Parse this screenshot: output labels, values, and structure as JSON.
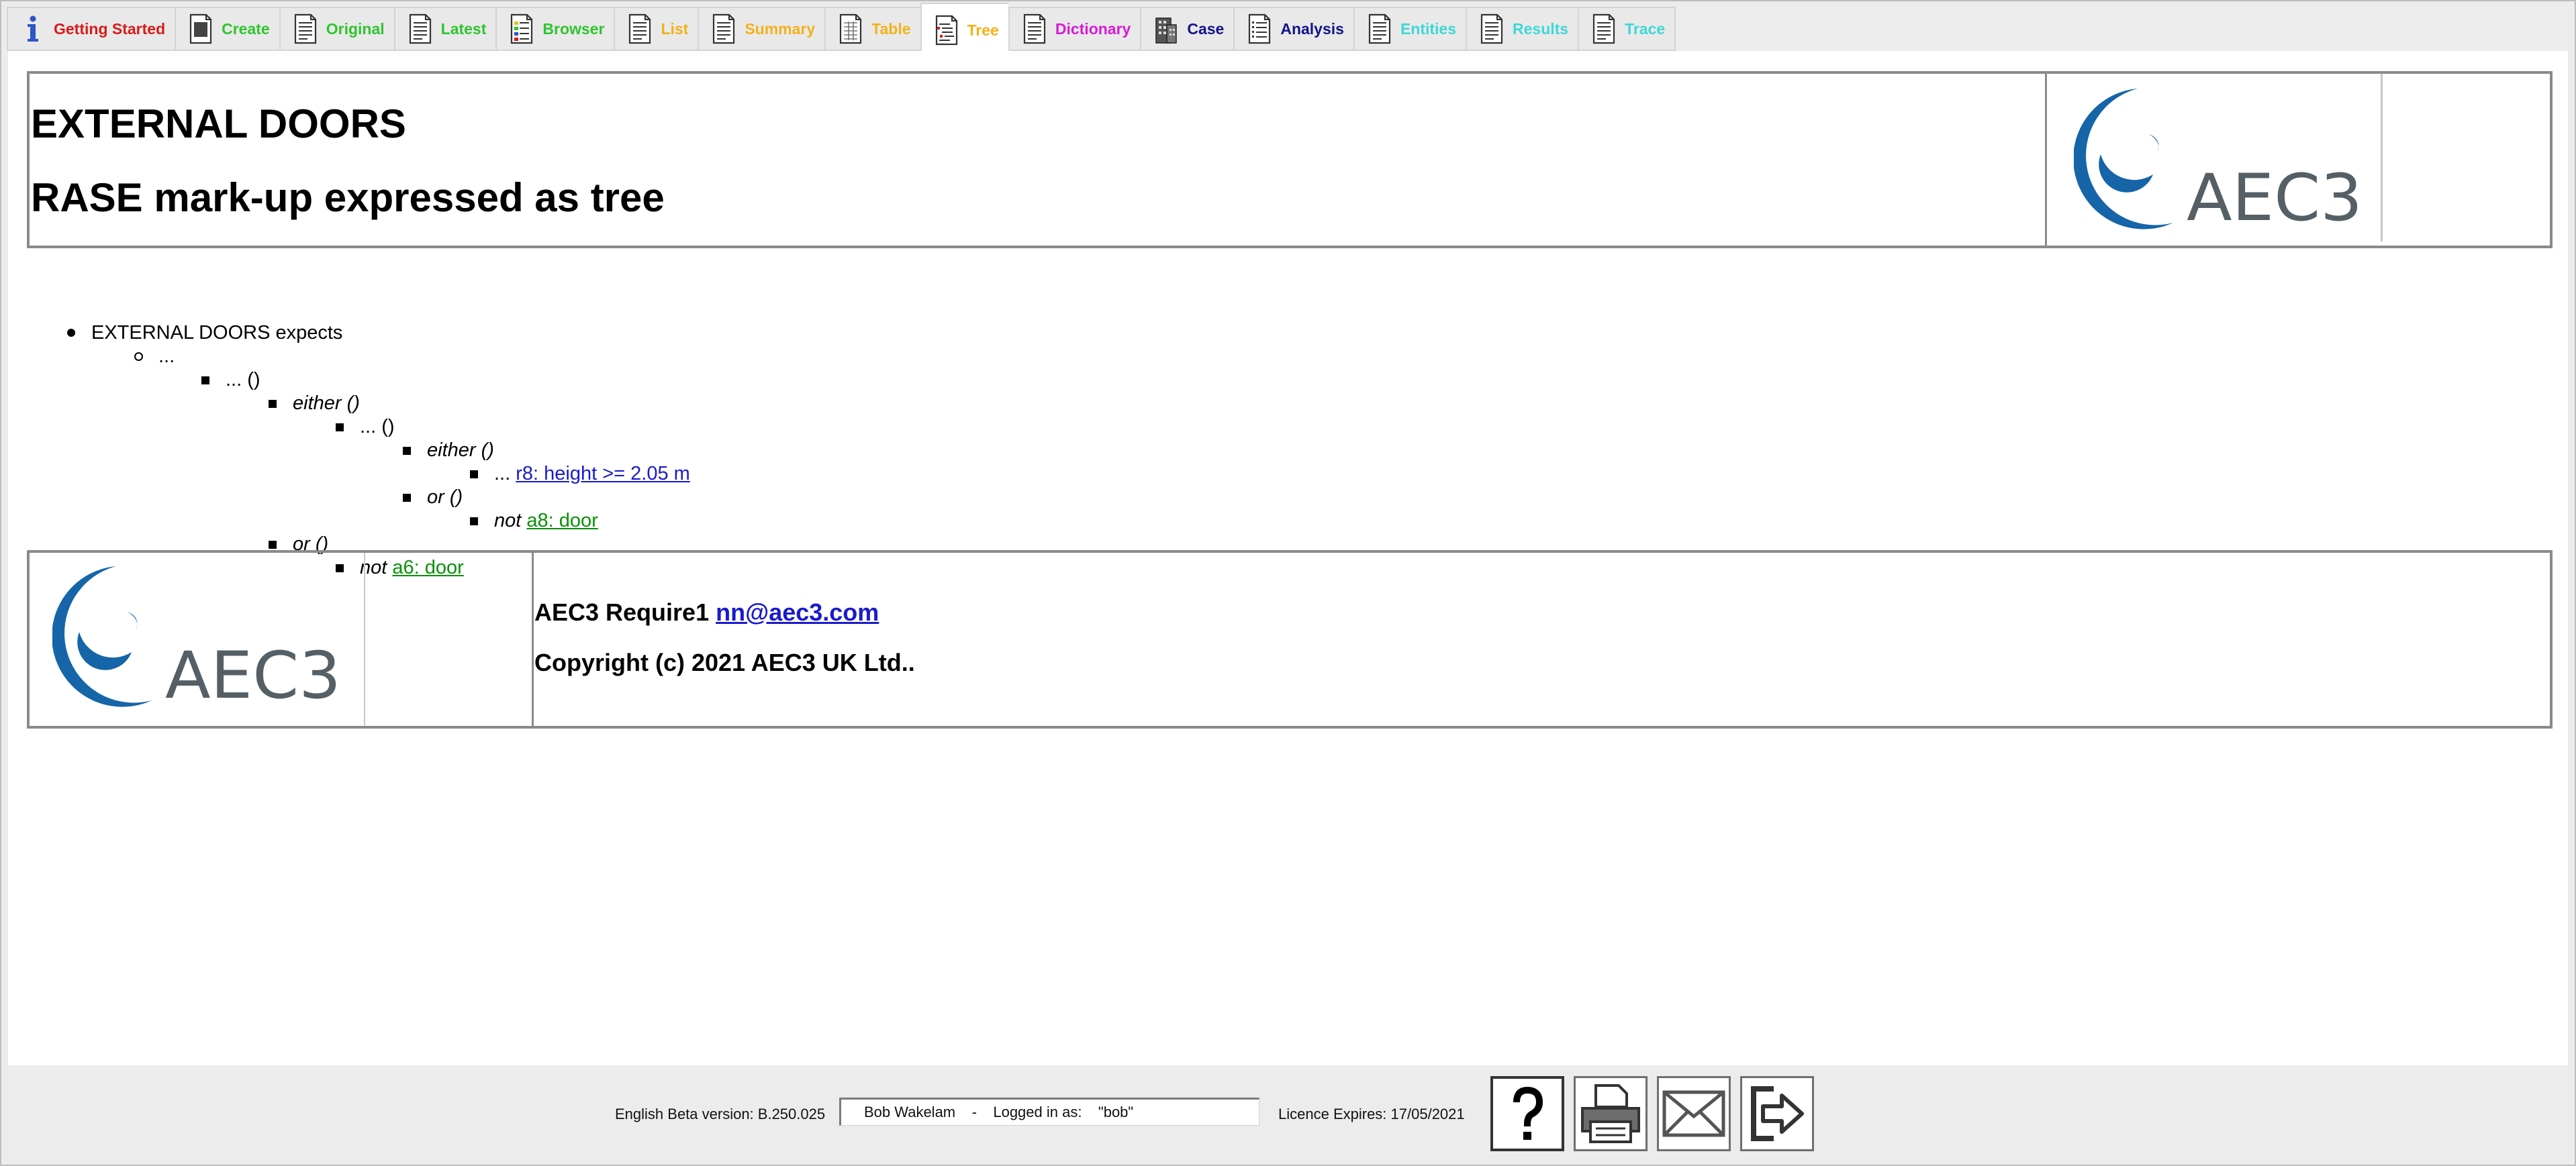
{
  "tabs": [
    {
      "label": "Getting Started",
      "color": "#d81b1b",
      "icon": "info-icon"
    },
    {
      "label": "Create",
      "color": "#2fc52f",
      "icon": "document-icon"
    },
    {
      "label": "Original",
      "color": "#2fc52f",
      "icon": "document-icon"
    },
    {
      "label": "Latest",
      "color": "#2fc52f",
      "icon": "document-icon"
    },
    {
      "label": "Browser",
      "color": "#2fc52f",
      "icon": "browser-document-icon"
    },
    {
      "label": "List",
      "color": "#f2b21a",
      "icon": "document-icon"
    },
    {
      "label": "Summary",
      "color": "#f2b21a",
      "icon": "document-icon"
    },
    {
      "label": "Table",
      "color": "#f2b21a",
      "icon": "document-icon"
    },
    {
      "label": "Tree",
      "color": "#f2b21a",
      "icon": "tree-document-icon"
    },
    {
      "label": "Dictionary",
      "color": "#d61bd6",
      "icon": "document-icon"
    },
    {
      "label": "Case",
      "color": "#14148c",
      "icon": "building-icon"
    },
    {
      "label": "Analysis",
      "color": "#14148c",
      "icon": "analysis-document-icon"
    },
    {
      "label": "Entities",
      "color": "#3fd7d7",
      "icon": "document-icon"
    },
    {
      "label": "Results",
      "color": "#3fd7d7",
      "icon": "document-icon"
    },
    {
      "label": "Trace",
      "color": "#3fd7d7",
      "icon": "document-icon"
    }
  ],
  "active_tab": "Tree",
  "header": {
    "title": "EXTERNAL DOORS",
    "subtitle": "RASE mark-up expressed as tree",
    "logo_text": "AEC3"
  },
  "tree": {
    "root": "EXTERNAL DOORS expects",
    "level1": "...",
    "level2": "... ()",
    "either_1": "either ()",
    "level4": "... ()",
    "either_2": "either ()",
    "r8_prefix": "...",
    "r8_link": "r8: height >= 2.05 m",
    "or_1": "or ()",
    "a8_not": "not",
    "a8_link": "a8: door",
    "or_2": "or ()",
    "a6_not": "not",
    "a6_link": "a6: door"
  },
  "footer": {
    "product": "AEC3 Require1",
    "email": "nn@aec3.com",
    "copyright": "Copyright (c) 2021 AEC3 UK Ltd..",
    "logo_text": "AEC3"
  },
  "status": {
    "version": "English Beta version: B.250.025",
    "user": "Bob Wakelam    -    Logged in as:    \"bob\"",
    "licence": "Licence Expires: 17/05/2021"
  },
  "colors": {
    "brand_blue": "#1565a8",
    "logo_text_gray": "#555f66",
    "link_blue": "#1a1acd",
    "link_green": "#079107"
  }
}
